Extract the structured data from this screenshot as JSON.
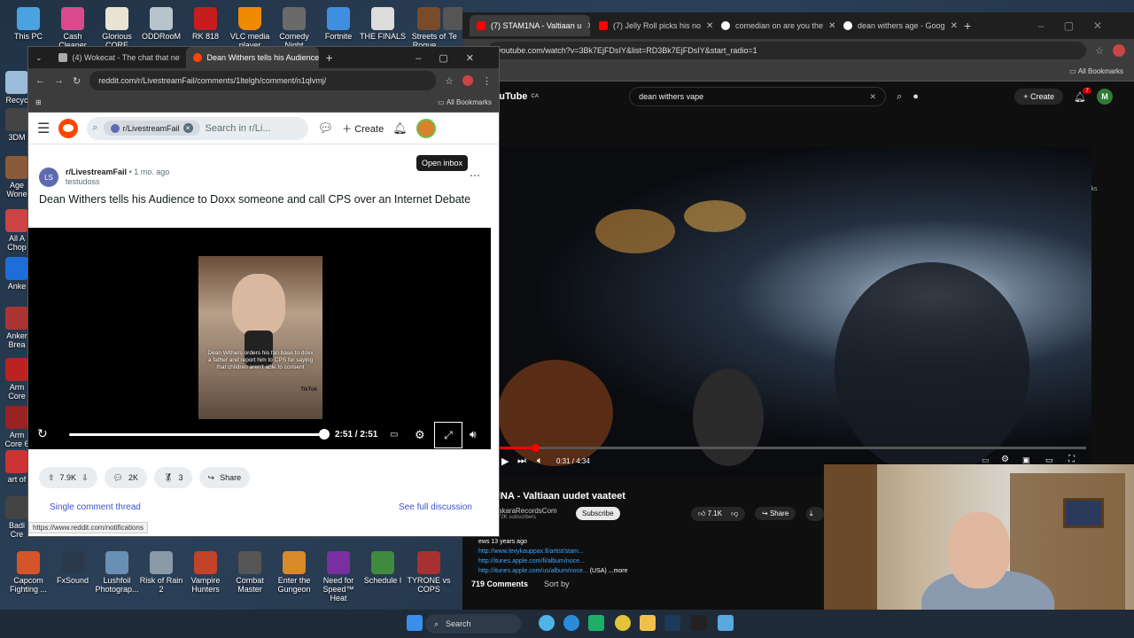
{
  "desktop": {
    "icons_top": [
      "This PC",
      "Cash Cleaner Simulator",
      "Glorious CORE",
      "ODDRooM",
      "RK 818",
      "VLC media player",
      "Comedy Night",
      "Fortnite",
      "THE FINALS",
      "Streets of Rogue ...",
      "Te"
    ],
    "icons_left": [
      "Recyc",
      "3DM",
      "Age Wone",
      "All A Chop",
      "Anke",
      "Anker Brea",
      "Arm Core",
      "Arm Core 6",
      "art of",
      "Badi Cre"
    ],
    "icons_bottom": [
      "Capcom Fighting ...",
      "FxSound",
      "Lushfoil Photograp...",
      "Risk of Rain 2",
      "Vampire Hunters",
      "Combat Master",
      "Enter the Gungeon",
      "Need for Speed™ Heat",
      "Schedule I",
      "TYRONE vs COPS"
    ]
  },
  "youtube_window": {
    "tabs": [
      "(7) STAM1NA - Valtiaan u",
      "(7) Jelly Roll picks his no",
      "comedian on are you the",
      "dean withers age - Goog"
    ],
    "url": "youtube.com/watch?v=3Bk7EjFDsIY&list=RD3Bk7EjFDsIY&start_radio=1",
    "bookmarks": "All Bookmarks",
    "logo": "YouTube",
    "logo_region": "CA",
    "search": "dean withers vape",
    "create": "Create",
    "notif_count": "7",
    "avatar": "M",
    "time": "0:31 / 4:34",
    "progress": 0.06,
    "title": "INA - Valtiaan uudet vaateet",
    "channel": "akaraRecordsCom",
    "subs": "72K subscribers",
    "subscribe": "Subscribe",
    "likes": "7.1K",
    "share": "Share",
    "desc_line1": "ews  13 years ago",
    "desc_line2": "http://www.levykauppax.fi/artist/stam...",
    "desc_line3": "http://itunes.apple.com/fi/album/noce...",
    "desc_line4": "http://itunes.apple.com/us/album/noce...",
    "desc_line4_tail": "(USA)  ...more",
    "comments": "719 Comments",
    "sort": "Sort by",
    "side_label": "okmarks"
  },
  "reddit_window": {
    "tabs": [
      "(4) Wokecat - The chat that ne",
      "Dean Withers tells his Audience"
    ],
    "url": "reddit.com/r/LivestreamFail/comments/1ltelgh/comment/n1qlvmj/",
    "bookmarks": "All Bookmarks",
    "search_chip": "r/LivestreamFail",
    "search_placeholder": "Search in r/Li...",
    "create": "Create",
    "tooltip": "Open inbox",
    "subreddit": "r/LivestreamFail",
    "sub_icon": "LS",
    "age": "• 1 mo. ago",
    "author": "testudoss",
    "title": "Dean Withers tells his Audience to Doxx someone and call CPS over an Internet Debate",
    "thumb_caption": "Dean Withers orders his fan base to doxx a father and report him to CPS for saying that children aren't able to consent",
    "thumb_tag": "TikTok",
    "video_time": "2:51 / 2:51",
    "video_progress": 1.0,
    "upvotes": "7.9K",
    "comments": "2K",
    "awards": "3",
    "share": "Share",
    "single_thread": "Single comment thread",
    "see_full": "See full discussion",
    "status_url": "https://www.reddit.com/notifications"
  },
  "taskbar": {
    "search": "Search"
  },
  "colors": {
    "reddit_orange": "#ff4500",
    "youtube_red": "#ff0000",
    "reddit_link": "#3c52c9"
  }
}
